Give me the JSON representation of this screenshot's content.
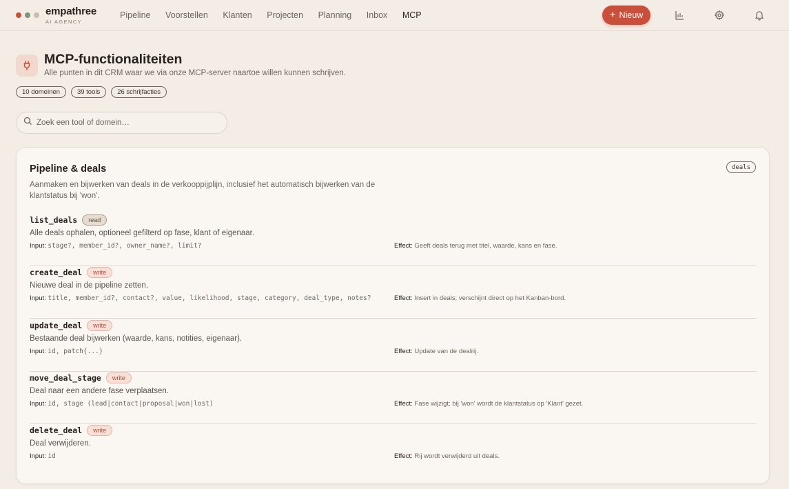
{
  "app": {
    "brand": "empathree",
    "brand_sub": "AI AGENCY"
  },
  "colors": {
    "accent": "#c94f3b",
    "dot_red": "#c94f3b",
    "dot_green": "#7f9477",
    "dot_tan": "#c8bdb1"
  },
  "nav": {
    "items": [
      {
        "label": "Pipeline"
      },
      {
        "label": "Voorstellen"
      },
      {
        "label": "Klanten"
      },
      {
        "label": "Projecten"
      },
      {
        "label": "Planning"
      },
      {
        "label": "Inbox"
      },
      {
        "label": "MCP",
        "active": true
      }
    ],
    "new_label": "Nieuw",
    "icons": [
      "chart-icon",
      "gear-icon",
      "bell-icon"
    ]
  },
  "header": {
    "icon": "plug-icon",
    "title": "MCP-functionaliteiten",
    "subtitle": "Alle punten in dit CRM waar we via onze MCP-server naartoe willen kunnen schrijven."
  },
  "stats": [
    "10 domeinen",
    "39 tools",
    "26 schrijfacties"
  ],
  "search": {
    "placeholder": "Zoek een tool of domein…",
    "value": ""
  },
  "domain": {
    "title": "Pipeline & deals",
    "tag": "deals",
    "description": "Aanmaken en bijwerken van deals in de verkooppijplijn, inclusief het automatisch bijwerken van de klantstatus bij 'won'.",
    "input_label": "Input:",
    "effect_label": "Effect:",
    "tools": [
      {
        "name": "list_deals",
        "badge": "read",
        "desc": "Alle deals ophalen, optioneel gefilterd op fase, klant of eigenaar.",
        "input": "stage?, member_id?, owner_name?, limit?",
        "effect": "Geeft deals terug met titel, waarde, kans en fase."
      },
      {
        "name": "create_deal",
        "badge": "write",
        "desc": "Nieuwe deal in de pipeline zetten.",
        "input": "title, member_id?, contact?, value, likelihood, stage, category, deal_type, notes?",
        "effect": "Insert in deals; verschijnt direct op het Kanban-bord."
      },
      {
        "name": "update_deal",
        "badge": "write",
        "desc": "Bestaande deal bijwerken (waarde, kans, notities, eigenaar).",
        "input": "id, patch{...}",
        "effect": "Update van de dealrij."
      },
      {
        "name": "move_deal_stage",
        "badge": "write",
        "desc": "Deal naar een andere fase verplaatsen.",
        "input": "id, stage (lead|contact|proposal|won|lost)",
        "effect": "Fase wijzigt; bij 'won' wordt de klantstatus op 'Klant' gezet."
      },
      {
        "name": "delete_deal",
        "badge": "write",
        "desc": "Deal verwijderen.",
        "input": "id",
        "effect": "Rij wordt verwijderd uit deals."
      }
    ]
  }
}
